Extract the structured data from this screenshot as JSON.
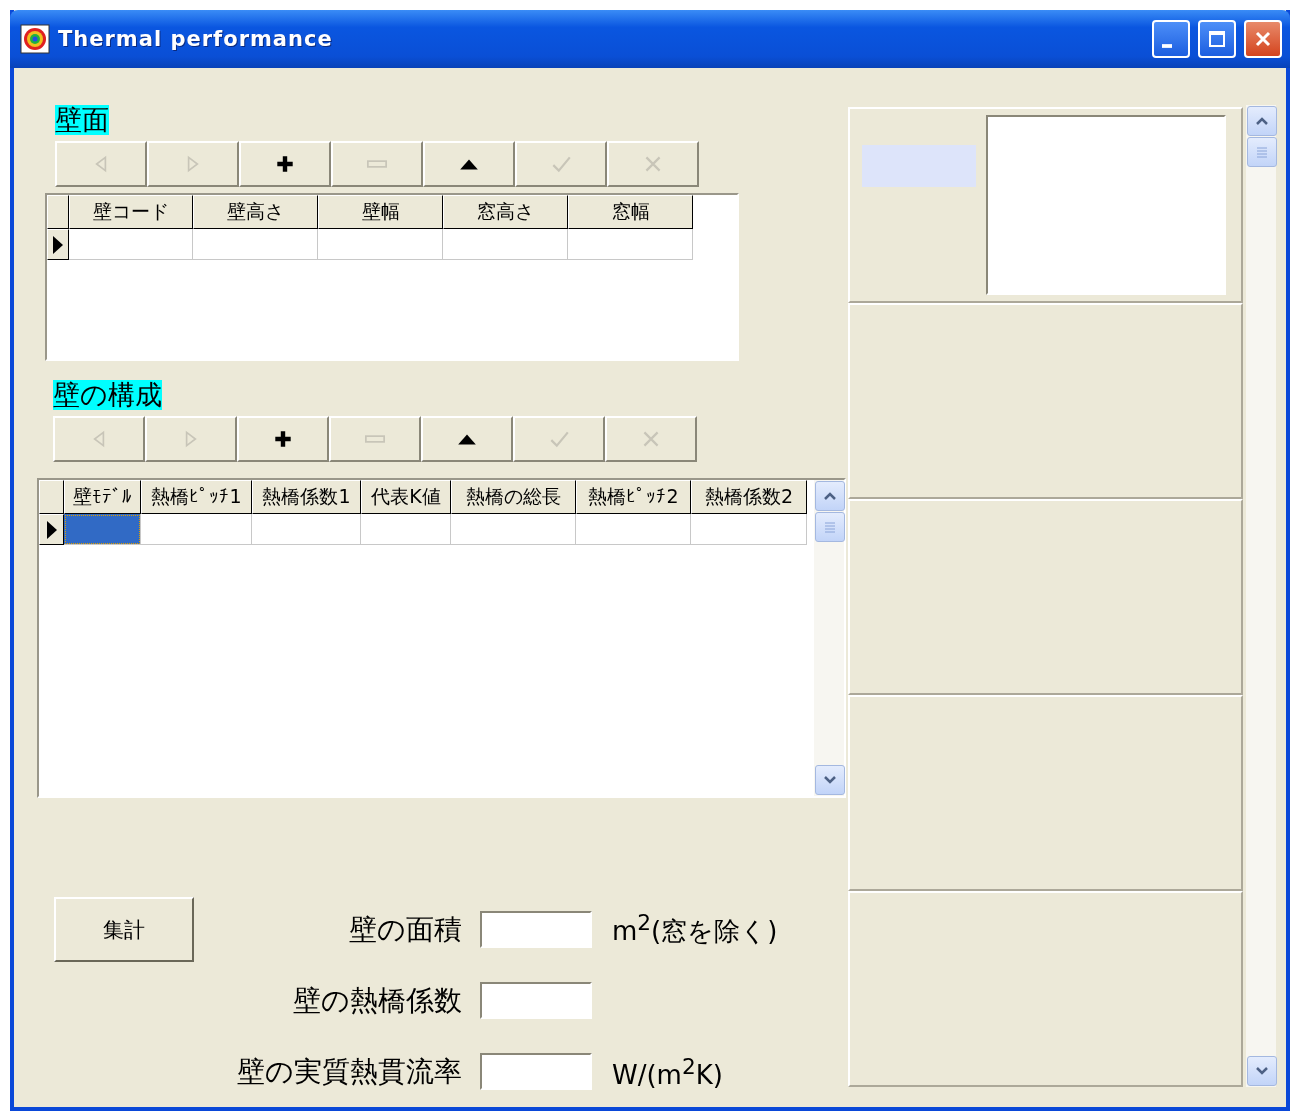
{
  "window": {
    "title": "Thermal performance",
    "controls": [
      {
        "kind": "minimize"
      },
      {
        "kind": "maximize"
      },
      {
        "kind": "close"
      }
    ]
  },
  "wall_section": {
    "heading": "壁面",
    "navigator": [
      {
        "kind": "prior",
        "disabled": true
      },
      {
        "kind": "next",
        "disabled": true
      },
      {
        "kind": "insert",
        "disabled": false
      },
      {
        "kind": "delete",
        "disabled": true
      },
      {
        "kind": "edit",
        "disabled": false
      },
      {
        "kind": "post",
        "disabled": true
      },
      {
        "kind": "cancel",
        "disabled": true
      }
    ],
    "grid": {
      "columns": [
        "壁コード",
        "壁高さ",
        "壁幅",
        "窓高さ",
        "窓幅"
      ],
      "rows": [
        {
          "current": true,
          "cells": [
            {
              "selected": false
            },
            {
              "selected": false
            },
            {
              "selected": false
            },
            {
              "selected": false
            },
            {
              "selected": false
            }
          ]
        }
      ]
    }
  },
  "composition_section": {
    "heading": "壁の構成",
    "navigator": [
      {
        "kind": "prior",
        "disabled": true
      },
      {
        "kind": "next",
        "disabled": true
      },
      {
        "kind": "insert",
        "disabled": false
      },
      {
        "kind": "delete",
        "disabled": true
      },
      {
        "kind": "edit",
        "disabled": false
      },
      {
        "kind": "post",
        "disabled": true
      },
      {
        "kind": "cancel",
        "disabled": true
      }
    ],
    "grid": {
      "columns": [
        "壁ﾓﾃﾞﾙ",
        "熱橋ﾋﾟｯﾁ1",
        "熱橋係数1",
        "代表K値",
        "熱橋の総長",
        "熱橋ﾋﾟｯﾁ2",
        "熱橋係数2"
      ],
      "rows": [
        {
          "current": true,
          "cells": [
            {
              "selected": true
            },
            {
              "selected": false
            },
            {
              "selected": false
            },
            {
              "selected": false
            },
            {
              "selected": false
            },
            {
              "selected": false
            },
            {
              "selected": false
            }
          ]
        }
      ]
    }
  },
  "summary": {
    "button": "集計",
    "fields": [
      {
        "label": "壁の面積",
        "unit": "m$^{2}$(窓を除く)"
      },
      {
        "label": "壁の熱橋係数"
      },
      {
        "label": "壁の実質熱貫流率",
        "unit": "W/(m$^{2}$K)"
      }
    ]
  }
}
